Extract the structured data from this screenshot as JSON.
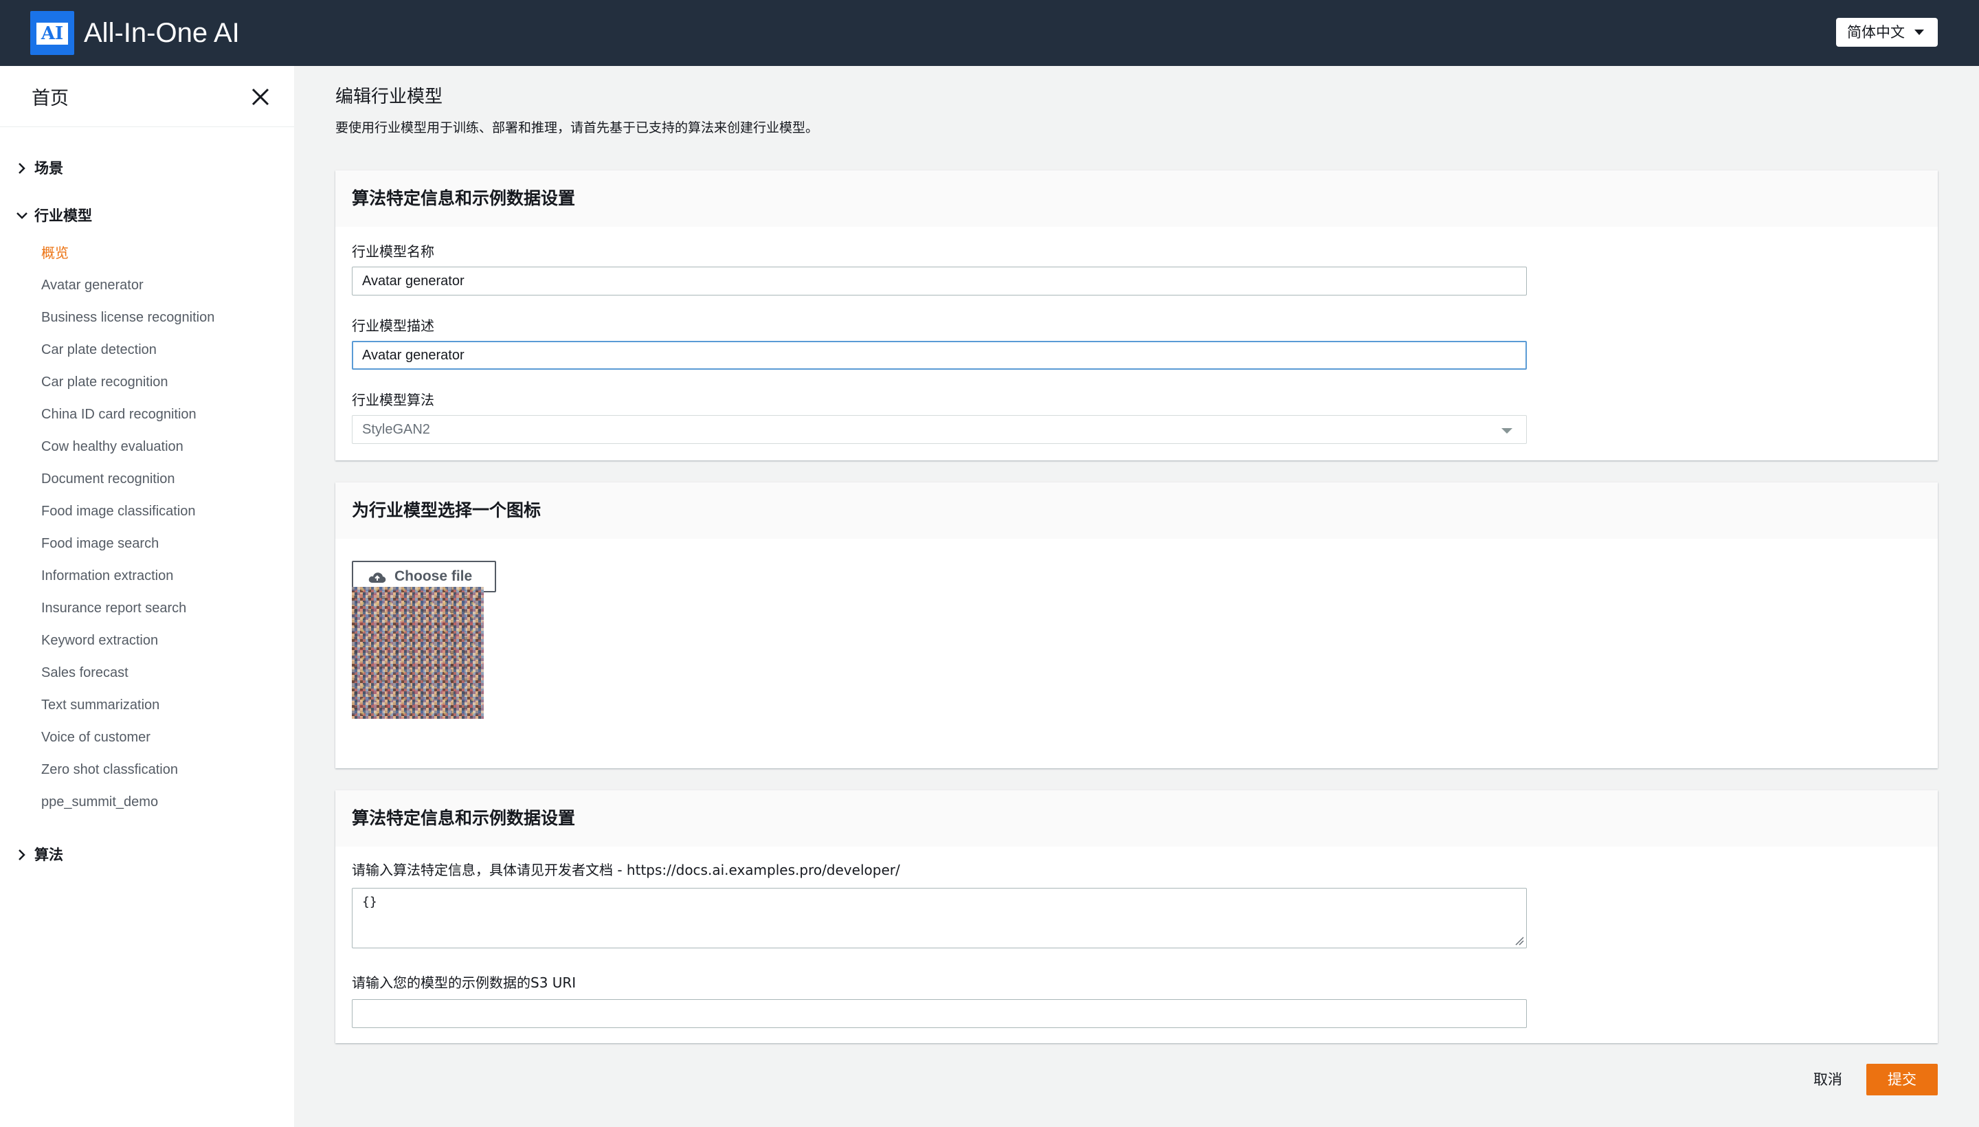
{
  "header": {
    "logo_text": "AI",
    "app_title": "All-In-One AI",
    "language": "简体中文"
  },
  "sidebar": {
    "home_label": "首页",
    "groups": [
      {
        "label": "场景",
        "expanded": false
      },
      {
        "label": "行业模型",
        "expanded": true
      },
      {
        "label": "算法",
        "expanded": false
      }
    ],
    "items": [
      {
        "label": "概览",
        "active": true
      },
      {
        "label": "Avatar generator"
      },
      {
        "label": "Business license recognition"
      },
      {
        "label": "Car plate detection"
      },
      {
        "label": "Car plate recognition"
      },
      {
        "label": "China ID card recognition"
      },
      {
        "label": "Cow healthy evaluation"
      },
      {
        "label": "Document recognition"
      },
      {
        "label": "Food image classification"
      },
      {
        "label": "Food image search"
      },
      {
        "label": "Information extraction"
      },
      {
        "label": "Insurance report search"
      },
      {
        "label": "Keyword extraction"
      },
      {
        "label": "Sales forecast"
      },
      {
        "label": "Text summarization"
      },
      {
        "label": "Voice of customer"
      },
      {
        "label": "Zero shot classfication"
      },
      {
        "label": "ppe_summit_demo"
      }
    ]
  },
  "main": {
    "title": "编辑行业模型",
    "description": "要使用行业模型用于训练、部署和推理，请首先基于已支持的算法来创建行业模型。",
    "panel1": {
      "heading": "算法特定信息和示例数据设置",
      "name_label": "行业模型名称",
      "name_value": "Avatar generator",
      "desc_label": "行业模型描述",
      "desc_value": "Avatar generator",
      "algo_label": "行业模型算法",
      "algo_value": "StyleGAN2"
    },
    "panel2": {
      "heading": "为行业模型选择一个图标",
      "choose_file": "Choose file"
    },
    "panel3": {
      "heading": "算法特定信息和示例数据设置",
      "info_label": "请输入算法特定信息，具体请见开发者文档 - https://docs.ai.examples.pro/developer/",
      "info_value": "{}",
      "s3_label": "请输入您的模型的示例数据的S3 URI",
      "s3_value": ""
    },
    "cancel": "取消",
    "submit": "提交"
  },
  "colors": {
    "header_bg": "#232f3e",
    "accent": "#ec7211",
    "logo_blue": "#1a73e8",
    "focus_border": "#5a9bd5"
  }
}
